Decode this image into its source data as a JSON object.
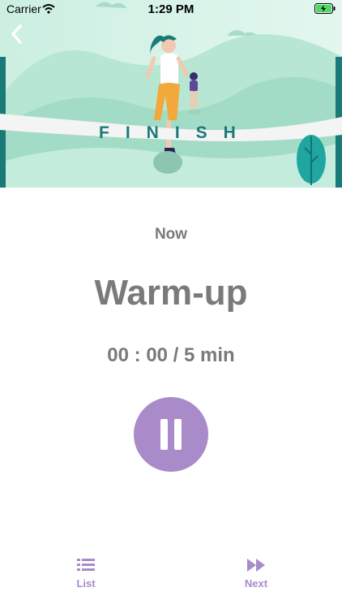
{
  "status_bar": {
    "carrier": "Carrier",
    "time": "1:29 PM"
  },
  "hero": {
    "banner_text": "FINISH"
  },
  "workout": {
    "now_label": "Now",
    "title": "Warm-up",
    "timer": "00 : 00 / 5 min"
  },
  "tabs": [
    {
      "label": "List",
      "icon": "list-icon"
    },
    {
      "label": "Next",
      "icon": "fast-forward-icon"
    }
  ],
  "colors": {
    "accent": "#a98bc9",
    "text": "#7a7a7a",
    "hero_bg": "#d9f3e8",
    "teal": "#1a7a78"
  }
}
